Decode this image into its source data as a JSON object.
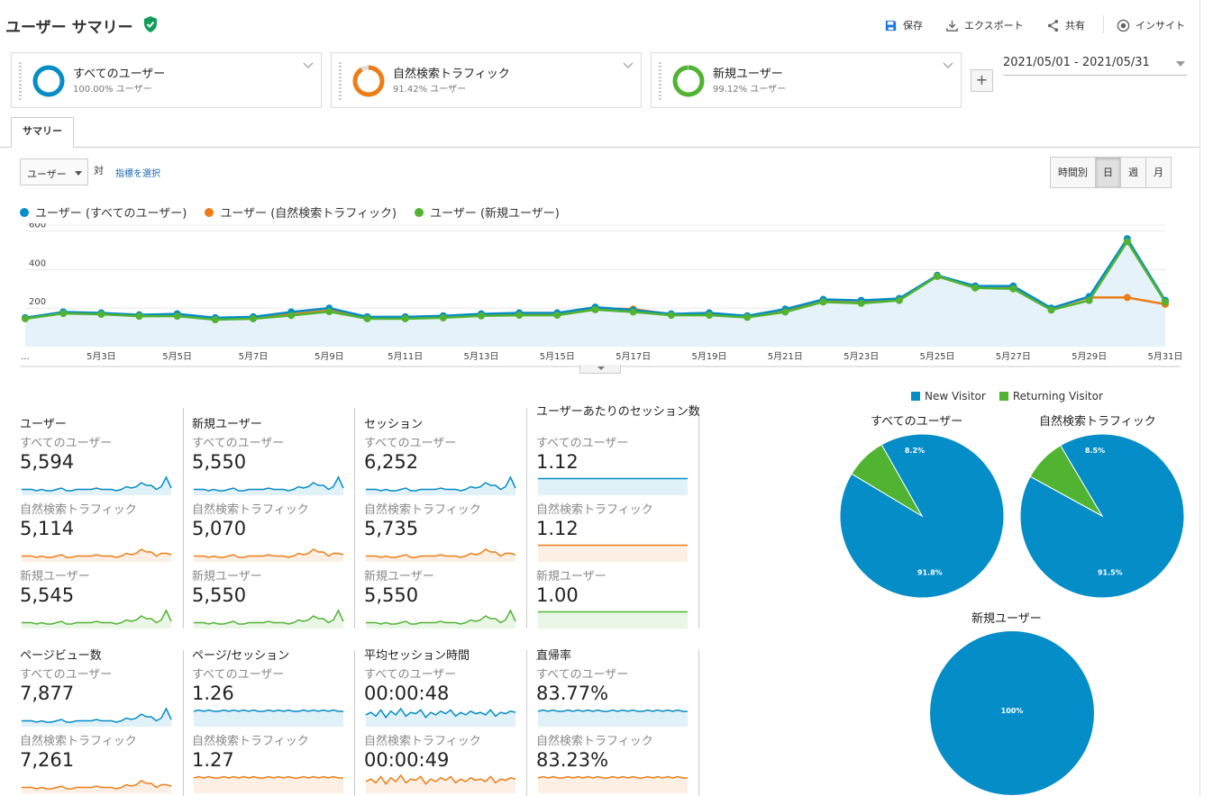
{
  "header": {
    "title": "ユーザー サマリー",
    "buttons": [
      {
        "label": "保存",
        "icon": "save-icon"
      },
      {
        "label": "エクスポート",
        "icon": "download-icon"
      },
      {
        "label": "共有",
        "icon": "share-icon"
      },
      {
        "label": "インサイト",
        "icon": "insights-icon"
      }
    ]
  },
  "segments": [
    {
      "name": "すべてのユーザー",
      "percent": "100.00% ユーザー",
      "color": "#058dc7",
      "fraction": 1.0
    },
    {
      "name": "自然検索トラフィック",
      "percent": "91.42% ユーザー",
      "color": "#ed7e17",
      "fraction": 0.9142
    },
    {
      "name": "新規ユーザー",
      "percent": "99.12% ユーザー",
      "color": "#50b432",
      "fraction": 0.9912
    }
  ],
  "add_segment_label": "+",
  "date_range": "2021/05/01 - 2021/05/31",
  "tabs": [
    "サマリー"
  ],
  "controls": {
    "metric_select": "ユーザー",
    "vs_label": "対",
    "select_metric_link": "指標を選択",
    "periods": [
      "時間別",
      "日",
      "週",
      "月"
    ],
    "active_period": "日"
  },
  "chart_data": {
    "type": "line",
    "title": "",
    "xlabel": "",
    "ylabel": "",
    "ylim": [
      0,
      640
    ],
    "y_ticks": [
      200,
      400,
      600
    ],
    "x": [
      "5月1日",
      "5月2日",
      "5月3日",
      "5月4日",
      "5月5日",
      "5月6日",
      "5月7日",
      "5月8日",
      "5月9日",
      "5月10日",
      "5月11日",
      "5月12日",
      "5月13日",
      "5月14日",
      "5月15日",
      "5月16日",
      "5月17日",
      "5月18日",
      "5月19日",
      "5月20日",
      "5月21日",
      "5月22日",
      "5月23日",
      "5月24日",
      "5月25日",
      "5月26日",
      "5月27日",
      "5月28日",
      "5月29日",
      "5月30日",
      "5月31日"
    ],
    "x_tick_labels": [
      "...",
      "5月3日",
      "5月5日",
      "5月7日",
      "5月9日",
      "5月11日",
      "5月13日",
      "5月15日",
      "5月17日",
      "5月19日",
      "5月21日",
      "5月23日",
      "5月25日",
      "5月27日",
      "5月29日",
      "5月31日"
    ],
    "series": [
      {
        "name": "ユーザー (すべてのユーザー)",
        "color": "#058dc7",
        "values": [
          150,
          180,
          175,
          165,
          170,
          150,
          155,
          180,
          200,
          155,
          155,
          160,
          170,
          175,
          175,
          205,
          190,
          170,
          175,
          160,
          195,
          245,
          240,
          250,
          370,
          315,
          315,
          200,
          260,
          560,
          240
        ]
      },
      {
        "name": "ユーザー (自然検索トラフィック)",
        "color": "#ed7e17",
        "values": [
          148,
          178,
          172,
          162,
          170,
          148,
          150,
          168,
          188,
          150,
          150,
          158,
          168,
          173,
          173,
          200,
          195,
          168,
          168,
          158,
          190,
          235,
          228,
          245,
          365,
          305,
          305,
          200,
          255,
          255,
          220
        ]
      },
      {
        "name": "ユーザー (新規ユーザー)",
        "color": "#50b432",
        "values": [
          145,
          172,
          168,
          158,
          158,
          140,
          145,
          162,
          182,
          145,
          145,
          150,
          160,
          163,
          163,
          192,
          180,
          163,
          163,
          152,
          180,
          232,
          225,
          240,
          365,
          305,
          300,
          190,
          240,
          545,
          232
        ]
      }
    ]
  },
  "metrics": [
    {
      "title": "ユーザー",
      "rows": [
        {
          "segment": "すべてのユーザー",
          "value": "5,594",
          "color": "#058dc7",
          "spark": [
            3,
            3,
            3,
            2,
            3,
            2,
            2,
            3,
            4,
            2,
            2,
            3,
            3,
            3,
            3,
            4,
            3,
            3,
            3,
            2,
            3,
            5,
            4,
            5,
            8,
            6,
            6,
            3,
            5,
            12,
            4
          ]
        },
        {
          "segment": "自然検索トラフィック",
          "value": "5,114",
          "color": "#ed7e17",
          "spark": [
            3,
            3,
            3,
            2,
            3,
            2,
            2,
            3,
            4,
            2,
            2,
            3,
            3,
            3,
            3,
            4,
            3,
            3,
            3,
            2,
            3,
            5,
            4,
            5,
            8,
            6,
            6,
            3,
            5,
            5,
            4
          ]
        },
        {
          "segment": "新規ユーザー",
          "value": "5,545",
          "color": "#50b432",
          "spark": [
            3,
            3,
            3,
            2,
            3,
            2,
            2,
            3,
            4,
            2,
            2,
            3,
            3,
            3,
            3,
            4,
            3,
            3,
            3,
            2,
            3,
            5,
            4,
            5,
            8,
            6,
            6,
            3,
            5,
            12,
            4
          ]
        }
      ]
    },
    {
      "title": "新規ユーザー",
      "rows": [
        {
          "segment": "すべてのユーザー",
          "value": "5,550",
          "color": "#058dc7",
          "spark": [
            3,
            3,
            3,
            2,
            3,
            2,
            2,
            3,
            4,
            2,
            2,
            3,
            3,
            3,
            3,
            4,
            3,
            3,
            3,
            2,
            3,
            5,
            4,
            5,
            8,
            6,
            6,
            3,
            5,
            12,
            4
          ]
        },
        {
          "segment": "自然検索トラフィック",
          "value": "5,070",
          "color": "#ed7e17",
          "spark": [
            3,
            3,
            3,
            2,
            3,
            2,
            2,
            3,
            4,
            2,
            2,
            3,
            3,
            3,
            3,
            4,
            3,
            3,
            3,
            2,
            3,
            5,
            4,
            5,
            8,
            6,
            6,
            3,
            5,
            5,
            4
          ]
        },
        {
          "segment": "新規ユーザー",
          "value": "5,550",
          "color": "#50b432",
          "spark": [
            3,
            3,
            3,
            2,
            3,
            2,
            2,
            3,
            4,
            2,
            2,
            3,
            3,
            3,
            3,
            4,
            3,
            3,
            3,
            2,
            3,
            5,
            4,
            5,
            8,
            6,
            6,
            3,
            5,
            12,
            4
          ]
        }
      ]
    },
    {
      "title": "セッション",
      "rows": [
        {
          "segment": "すべてのユーザー",
          "value": "6,252",
          "color": "#058dc7",
          "spark": [
            3,
            3,
            3,
            2,
            3,
            2,
            2,
            3,
            4,
            2,
            2,
            3,
            3,
            3,
            3,
            4,
            3,
            3,
            3,
            2,
            3,
            5,
            4,
            5,
            8,
            6,
            6,
            3,
            5,
            12,
            4
          ]
        },
        {
          "segment": "自然検索トラフィック",
          "value": "5,735",
          "color": "#ed7e17",
          "spark": [
            3,
            3,
            3,
            2,
            3,
            2,
            2,
            3,
            4,
            2,
            2,
            3,
            3,
            3,
            3,
            4,
            3,
            3,
            3,
            2,
            3,
            5,
            4,
            5,
            8,
            6,
            6,
            3,
            5,
            5,
            4
          ]
        },
        {
          "segment": "新規ユーザー",
          "value": "5,550",
          "color": "#50b432",
          "spark": [
            3,
            3,
            3,
            2,
            3,
            2,
            2,
            3,
            4,
            2,
            2,
            3,
            3,
            3,
            3,
            4,
            3,
            3,
            3,
            2,
            3,
            5,
            4,
            5,
            8,
            6,
            6,
            3,
            5,
            12,
            4
          ]
        }
      ]
    },
    {
      "title": "ユーザーあたりのセッション数",
      "rows": [
        {
          "segment": "すべてのユーザー",
          "value": "1.12",
          "color": "#058dc7",
          "spark": [
            11,
            11,
            11,
            11,
            11,
            11,
            11,
            11,
            11,
            11,
            11,
            11,
            11,
            11,
            11,
            11,
            11,
            11,
            11,
            11,
            11,
            11,
            11,
            11,
            11,
            11,
            11,
            11,
            11,
            11,
            11
          ]
        },
        {
          "segment": "自然検索トラフィック",
          "value": "1.12",
          "color": "#ed7e17",
          "spark": [
            11,
            11,
            11,
            11,
            11,
            11,
            11,
            11,
            11,
            11,
            11,
            11,
            11,
            11,
            11,
            11,
            11,
            11,
            11,
            11,
            11,
            11,
            11,
            11,
            11,
            11,
            11,
            11,
            11,
            11,
            11
          ]
        },
        {
          "segment": "新規ユーザー",
          "value": "1.00",
          "color": "#50b432",
          "spark": [
            11,
            11,
            11,
            11,
            11,
            11,
            11,
            11,
            11,
            11,
            11,
            11,
            11,
            11,
            11,
            11,
            11,
            11,
            11,
            11,
            11,
            11,
            11,
            11,
            11,
            11,
            11,
            11,
            11,
            11,
            11
          ]
        }
      ]
    },
    {
      "title": "ページビュー数",
      "rows": [
        {
          "segment": "すべてのユーザー",
          "value": "7,877",
          "color": "#058dc7",
          "spark": [
            3,
            3,
            3,
            2,
            3,
            2,
            2,
            3,
            4,
            2,
            2,
            3,
            3,
            3,
            3,
            4,
            3,
            3,
            3,
            2,
            3,
            5,
            4,
            5,
            8,
            6,
            6,
            3,
            5,
            12,
            4
          ]
        },
        {
          "segment": "自然検索トラフィック",
          "value": "7,261",
          "color": "#ed7e17",
          "spark": [
            3,
            3,
            3,
            2,
            3,
            2,
            2,
            3,
            4,
            2,
            2,
            3,
            3,
            3,
            3,
            4,
            3,
            3,
            3,
            2,
            3,
            5,
            4,
            5,
            8,
            6,
            6,
            3,
            5,
            5,
            4
          ]
        }
      ]
    },
    {
      "title": "ページ/セッション",
      "rows": [
        {
          "segment": "すべてのユーザー",
          "value": "1.26",
          "color": "#058dc7",
          "spark": [
            10,
            11,
            10,
            11,
            10,
            10,
            11,
            10,
            11,
            10,
            11,
            10,
            11,
            10,
            10,
            11,
            10,
            11,
            10,
            11,
            10,
            10,
            11,
            10,
            11,
            10,
            11,
            10,
            11,
            10,
            10
          ]
        },
        {
          "segment": "自然検索トラフィック",
          "value": "1.27",
          "color": "#ed7e17",
          "spark": [
            10,
            11,
            10,
            11,
            10,
            10,
            11,
            10,
            11,
            10,
            11,
            10,
            11,
            10,
            10,
            11,
            10,
            11,
            10,
            11,
            10,
            10,
            11,
            10,
            11,
            10,
            11,
            10,
            11,
            10,
            10
          ]
        }
      ]
    },
    {
      "title": "平均セッション時間",
      "rows": [
        {
          "segment": "すべてのユーザー",
          "value": "00:00:48",
          "color": "#058dc7",
          "spark": [
            8,
            10,
            7,
            12,
            6,
            11,
            8,
            13,
            7,
            10,
            9,
            12,
            6,
            10,
            8,
            11,
            9,
            12,
            7,
            10,
            8,
            11,
            9,
            10,
            8,
            12,
            7,
            10,
            9,
            11,
            10
          ]
        },
        {
          "segment": "自然検索トラフィック",
          "value": "00:00:49",
          "color": "#ed7e17",
          "spark": [
            8,
            10,
            7,
            12,
            6,
            11,
            8,
            13,
            7,
            10,
            9,
            12,
            6,
            10,
            8,
            11,
            9,
            12,
            7,
            10,
            8,
            11,
            9,
            10,
            8,
            12,
            7,
            10,
            9,
            11,
            10
          ]
        }
      ]
    },
    {
      "title": "直帰率",
      "rows": [
        {
          "segment": "すべてのユーザー",
          "value": "83.77%",
          "color": "#058dc7",
          "spark": [
            10,
            11,
            10,
            11,
            10,
            10,
            11,
            10,
            11,
            10,
            11,
            10,
            11,
            10,
            10,
            11,
            10,
            11,
            10,
            11,
            10,
            10,
            11,
            10,
            11,
            10,
            11,
            10,
            11,
            10,
            10
          ]
        },
        {
          "segment": "自然検索トラフィック",
          "value": "83.23%",
          "color": "#ed7e17",
          "spark": [
            10,
            11,
            10,
            11,
            10,
            10,
            11,
            10,
            11,
            10,
            11,
            10,
            11,
            10,
            10,
            11,
            10,
            11,
            10,
            11,
            10,
            10,
            11,
            10,
            11,
            10,
            11,
            10,
            11,
            10,
            10
          ]
        }
      ]
    }
  ],
  "pie_legend": [
    {
      "label": "New Visitor",
      "color": "#058dc7"
    },
    {
      "label": "Returning Visitor",
      "color": "#50b432"
    }
  ],
  "pies": [
    {
      "title": "すべてのユーザー",
      "values": [
        91.8,
        8.2
      ],
      "labels": [
        "91.8%",
        "8.2%"
      ]
    },
    {
      "title": "自然検索トラフィック",
      "values": [
        91.5,
        8.5
      ],
      "labels": [
        "91.5%",
        "8.5%"
      ]
    },
    {
      "title": "新規ユーザー",
      "values": [
        100,
        0
      ],
      "labels": [
        "100%",
        ""
      ]
    }
  ]
}
